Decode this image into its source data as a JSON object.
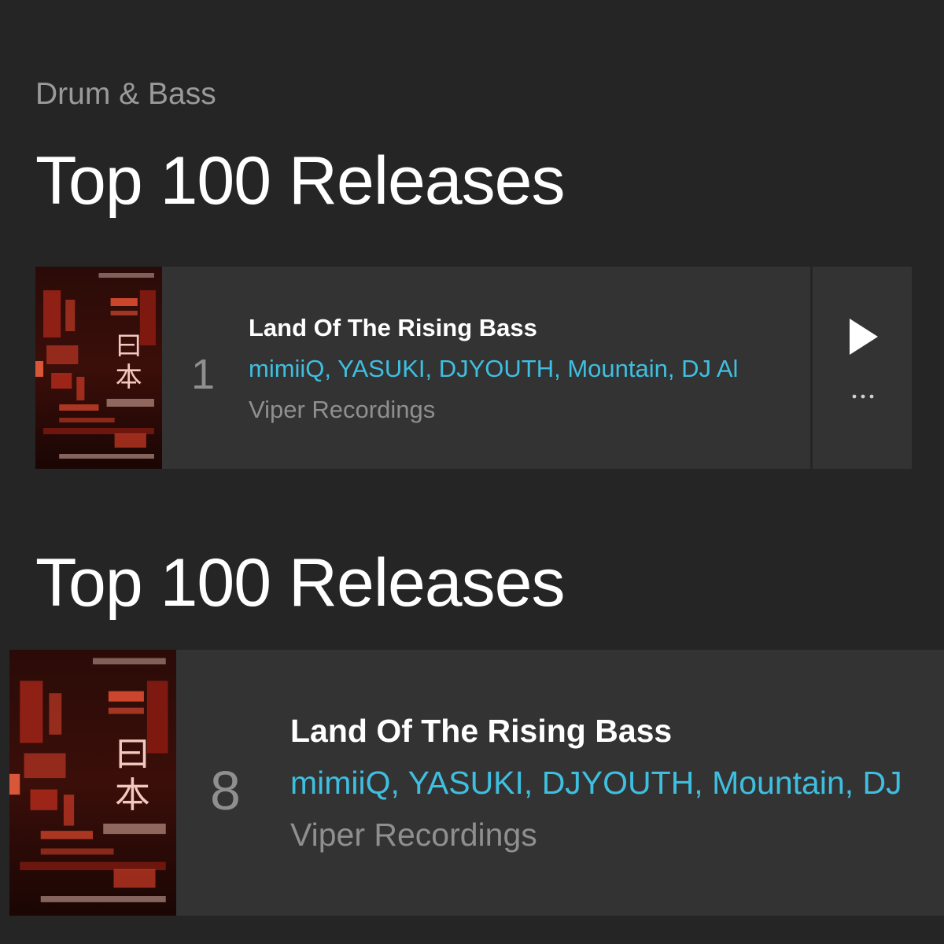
{
  "genre": "Drum & Bass",
  "sections": [
    {
      "heading": "Top 100 Releases",
      "release": {
        "rank": "1",
        "title": "Land Of The Rising Bass",
        "artists": "mimiiQ, YASUKI, DJYOUTH, Mountain, DJ Al",
        "label": "Viper Recordings",
        "cover_alt": "Land Of The Rising Bass cover art"
      },
      "actions": {
        "play_icon": "play-icon",
        "more_icon": "more-dots-icon"
      }
    },
    {
      "heading": "Top 100 Releases",
      "release": {
        "rank": "8",
        "title": "Land Of The Rising Bass",
        "artists": "mimiiQ, YASUKI, DJYOUTH, Mountain, DJ",
        "label": "Viper Recordings",
        "cover_alt": "Land Of The Rising Bass cover art"
      }
    }
  ],
  "colors": {
    "background": "#252525",
    "row_background": "#333333",
    "artist_link": "#3fbfe0",
    "muted_text": "#8f8f8f",
    "primary_text": "#ffffff",
    "cover_accent": "#e8392a"
  }
}
